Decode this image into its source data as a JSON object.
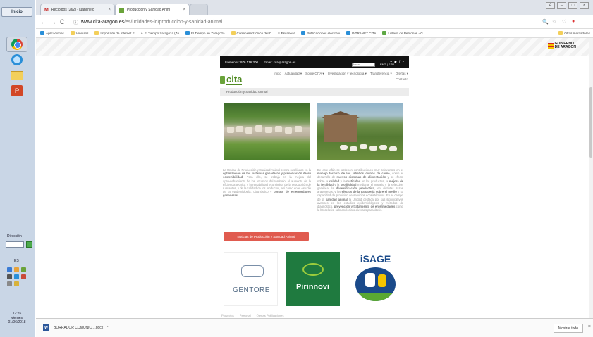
{
  "taskbar": {
    "start_label": "Inicio",
    "direccion_label": "Dirección",
    "lang": "ES",
    "clock_time": "12:26",
    "clock_day": "viernes",
    "clock_date": "01/06/2018"
  },
  "tabs": [
    {
      "title": "Recibidos (262) - juanchelo",
      "icon": "gmail-icon"
    },
    {
      "title": "Producción y Sanidad Anim",
      "icon": "cita-icon"
    }
  ],
  "toolbar": {
    "url_host": "www.cita-aragon.es",
    "url_path": "/es/unidades-id/produccion-y-sanidad-animal"
  },
  "bookmarks": [
    "Aplicaciones",
    "Vínculos",
    "Importado de Internet E",
    "El Tiempo Zaragoza (Zo",
    "El Tiempo en Zaragoza",
    "Correo electrónico del C",
    "Escanear",
    "Publicaciones electróni",
    "INTRANET CITA",
    "Listado de Personas - G",
    "Otros marcadores"
  ],
  "site": {
    "gov_logo_line1": "GOBIERNO",
    "gov_logo_line2": "DE ARAGON",
    "phone": "Llámenos: 976 716 300",
    "email": "Email: cita@aragon.es",
    "search_placeholder": "Buscar",
    "lang_switch": "ENG | ESP",
    "logo_text": "cita",
    "nav": [
      "Inicio",
      "Actualidad ▾",
      "Sobre CITA ▾",
      "Investigación y tecnología ▾",
      "Transferencia ▾",
      "Ofertas ▾",
      "Contacto"
    ],
    "breadcrumb": "Producción y Sanidad Animal",
    "news_button": "Noticias de Producción y Sanidad Animal",
    "partner_gentore": "GENTORE",
    "partner_pirinnovi": "Pirinnovi",
    "partner_isage": "iSAGE",
    "footer_links": [
      "Proyectos",
      "Personal",
      "Ofertas Publicaciones"
    ]
  },
  "downloads": {
    "file": "BORRADOR COMUNIC....docx",
    "show_all": "Mostrar todo"
  },
  "colors": {
    "accent_green": "#4f8a22",
    "news_button": "#e05b4f",
    "contact_bar": "#111111"
  }
}
